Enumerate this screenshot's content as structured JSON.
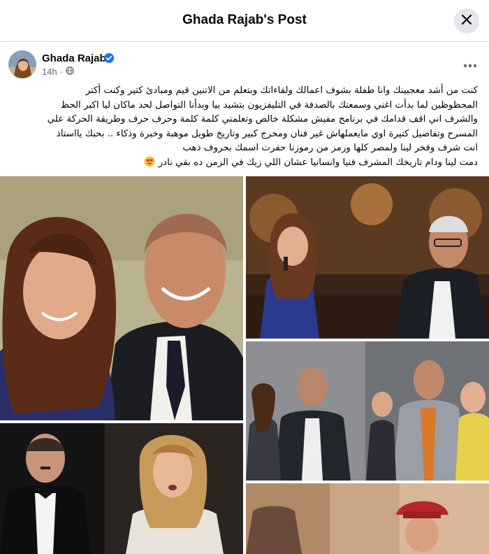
{
  "header": {
    "title": "Ghada Rajab's Post"
  },
  "post": {
    "author": "Ghada Rajab",
    "time": "14h",
    "privacy_icon": "globe-icon",
    "text_lines": [
      "كنت من أشد معجبينك وانا طفلة بشوف اعمالك ولقاءاتك وبتعلم من الاتنين قيم ومبادئ كتير وكنت أكتر",
      "المحظوظين لما بدأت اغني وسمعتك بالصدفة في التليفزيون بتشيد بيا وبدأنا التواصل لحد ماكان ليا اكبر الحظ",
      "والشرف اني اقف قدامك في برنامج مفيش مشكلة خالص وتعلمني كلمة كلمة وحرف حرف وطريقة الحركة علي",
      "المسرح وتفاصيل كتيرة اوي مايعملهاش غير فنان ومخرج كبير وتاريخ طويل موهبة وخبرة وذكاء .. بحبك يااستاذ",
      "انت شرف وفخر لينا ولمصر كلها ورمز من رموزنا حفرت اسمك بحروف ذهب",
      "دمت لينا ودام تاريخك المشرف فنيا وانسانيا عشان اللي زيك في الزمن ده بقي نادر"
    ],
    "emoji": "heart-eyes-emoji"
  },
  "photos": [
    {
      "name": "photo-selfie-couple"
    },
    {
      "name": "photo-stage-singer"
    },
    {
      "name": "photo-group-wax-figure"
    },
    {
      "name": "photo-stage-performance"
    },
    {
      "name": "photo-partial-bottom"
    }
  ],
  "colors": {
    "accent": "#1877f2",
    "secondary_text": "#65676b",
    "divider": "#dadde1"
  }
}
